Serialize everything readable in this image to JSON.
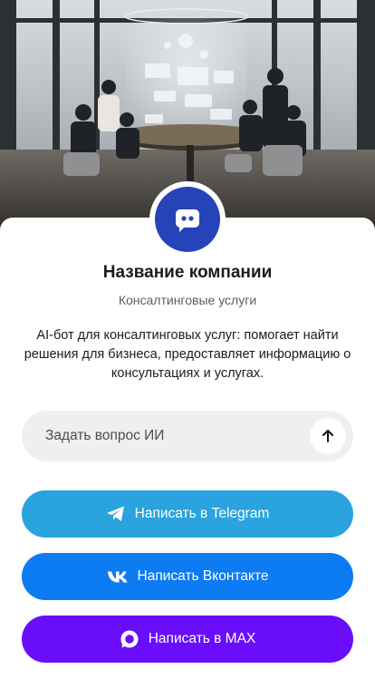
{
  "hero": {
    "image": "consulting-team-meeting-photo"
  },
  "profile": {
    "avatar_icon": "chat-bot-icon",
    "avatar_color": "#2743b8",
    "company_name": "Название компании",
    "category": "Консалтинговые услуги",
    "description": "AI-бот для консалтинговых услуг: помогает найти решения для бизнеса, предоставляет информацию о консультациях и услугах."
  },
  "ask": {
    "placeholder": "Задать вопрос ИИ",
    "value": "",
    "send_icon": "arrow-up-icon"
  },
  "buttons": [
    {
      "label": "Написать в Telegram",
      "icon": "telegram-icon",
      "color": "#2aa3de"
    },
    {
      "label": "Написать Вконтакте",
      "icon": "vk-icon",
      "color": "#0d7bf2"
    },
    {
      "label": "Написать в MAX",
      "icon": "max-icon",
      "color": "#6a0dfb"
    }
  ]
}
